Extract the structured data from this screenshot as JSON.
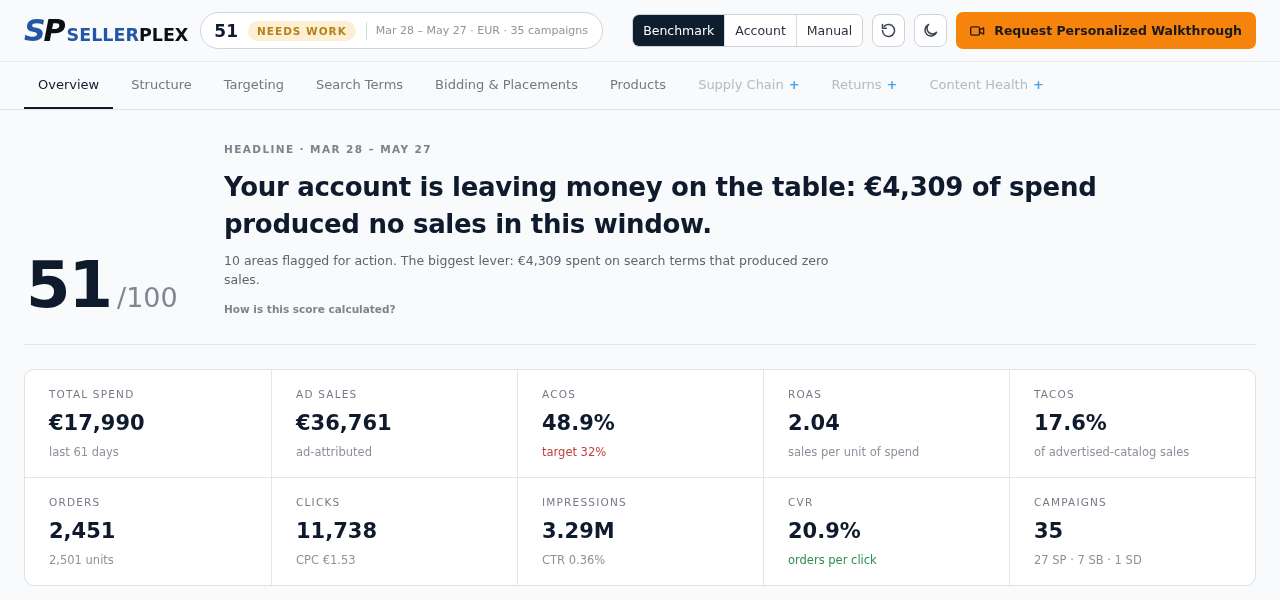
{
  "logo": {
    "mark_parts": [
      "S",
      "P"
    ],
    "name_parts": [
      "SELLER",
      "PLEX"
    ]
  },
  "score_pill": {
    "score": "51",
    "status": "NEEDS WORK",
    "meta": "Mar 28 – May 27 · EUR · 35 campaigns"
  },
  "view_modes": [
    {
      "label": "Benchmark",
      "selected": true
    },
    {
      "label": "Account",
      "selected": false
    },
    {
      "label": "Manual",
      "selected": false
    }
  ],
  "cta_button": {
    "label": "Request Personalized Walkthrough"
  },
  "tabs": [
    {
      "label": "Overview",
      "selected": true,
      "disabled": false
    },
    {
      "label": "Structure",
      "selected": false,
      "disabled": false
    },
    {
      "label": "Targeting",
      "selected": false,
      "disabled": false
    },
    {
      "label": "Search Terms",
      "selected": false,
      "disabled": false
    },
    {
      "label": "Bidding & Placements",
      "selected": false,
      "disabled": false
    },
    {
      "label": "Products",
      "selected": false,
      "disabled": false
    },
    {
      "label": "Supply Chain",
      "addon": "+",
      "selected": false,
      "disabled": true
    },
    {
      "label": "Returns",
      "addon": "+",
      "selected": false,
      "disabled": true
    },
    {
      "label": "Content Health",
      "addon": "+",
      "selected": false,
      "disabled": true
    }
  ],
  "hero": {
    "score": "51",
    "score_max": "/100",
    "eyebrow": "HEADLINE · MAR 28 – MAY 27",
    "headline": "Your account is leaving money on the table: €4,309 of spend produced no sales in this window.",
    "summary": "10 areas flagged for action. The biggest lever: €4,309 spent on search terms that produced zero sales.",
    "link": "How is this score calculated?"
  },
  "metrics": [
    {
      "label": "TOTAL SPEND",
      "value": "€17,990",
      "note": "last 61 days",
      "kind": "plain"
    },
    {
      "label": "AD SALES",
      "value": "€36,761",
      "note": "ad-attributed",
      "kind": "plain"
    },
    {
      "label": "ACOS",
      "value": "48.9%",
      "note": "target 32%",
      "kind": "bad"
    },
    {
      "label": "ROAS",
      "value": "2.04",
      "note": "sales per unit of spend",
      "kind": "plain"
    },
    {
      "label": "TACOS",
      "value": "17.6%",
      "note": "of advertised-catalog sales",
      "kind": "plain"
    },
    {
      "label": "ORDERS",
      "value": "2,451",
      "note": "2,501 units",
      "kind": "plain"
    },
    {
      "label": "CLICKS",
      "value": "11,738",
      "note": "CPC €1.53",
      "kind": "plain"
    },
    {
      "label": "IMPRESSIONS",
      "value": "3.29M",
      "note": "CTR 0.36%",
      "kind": "plain"
    },
    {
      "label": "CVR",
      "value": "20.9%",
      "note": "orders per click",
      "kind": "good"
    },
    {
      "label": "CAMPAIGNS",
      "value": "35",
      "note": "27 SP · 7 SB · 1 SD",
      "kind": "plain"
    }
  ]
}
